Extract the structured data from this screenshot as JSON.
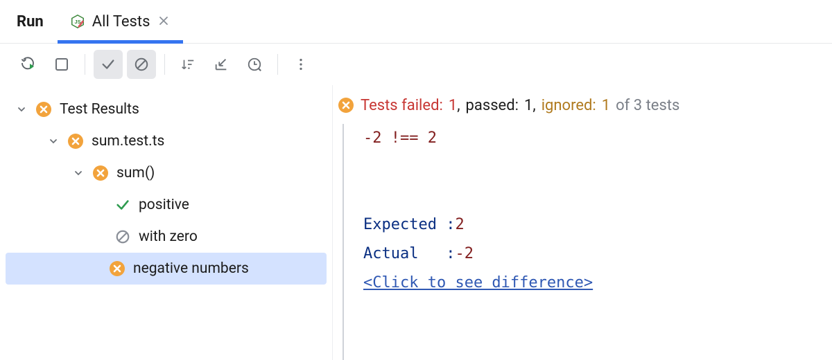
{
  "header": {
    "run_label": "Run",
    "active_tab_label": "All Tests"
  },
  "summary": {
    "failed_label": "Tests failed:",
    "failed_count": 1,
    "passed_label": "passed:",
    "passed_count": 1,
    "ignored_label": "ignored:",
    "ignored_count": 1,
    "of_label": "of 3 tests"
  },
  "tree": {
    "root_label": "Test Results",
    "file_label": "sum.test.ts",
    "suite_label": "sum()",
    "tests": {
      "pass_label": "positive",
      "ignored_label": "with zero",
      "fail_label": "negative numbers"
    }
  },
  "console": {
    "assertion_line": "-2 !== 2",
    "expected_label": "Expected :",
    "expected_value": "2",
    "actual_label": "Actual   :",
    "actual_value": "-2",
    "diff_link": "<Click to see difference>"
  }
}
